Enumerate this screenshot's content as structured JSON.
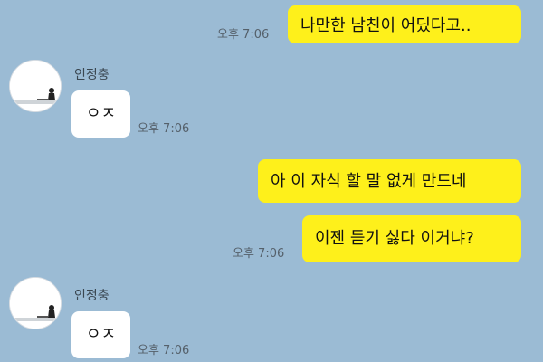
{
  "chat": {
    "messages": [
      {
        "sender": "me",
        "text": "나만한 남친이 어딨다고..",
        "time": "오후 7:06"
      },
      {
        "sender": "인정충",
        "text": "ㅇㅈ",
        "time": "오후 7:06"
      },
      {
        "sender": "me",
        "text": "아 이 자식 할 말 없게 만드네",
        "time": ""
      },
      {
        "sender": "me",
        "text": "이젠 듣기 싫다 이거냐?",
        "time": "오후 7:06"
      },
      {
        "sender": "인정충",
        "text": "ㅇㅈ",
        "time": "오후 7:06"
      }
    ],
    "contact": {
      "name": "인정충",
      "avatar_icon": "profile-photo-icon"
    }
  },
  "colors": {
    "background": "#9bbbd4",
    "my_bubble": "#fef01b",
    "their_bubble": "#ffffff"
  }
}
